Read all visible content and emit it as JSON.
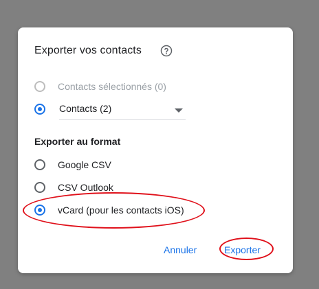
{
  "dialog": {
    "title": "Exporter vos contacts",
    "help_icon": "help-circle-icon",
    "scope": {
      "options": [
        {
          "label": "Contacts sélectionnés (0)",
          "state": "disabled"
        },
        {
          "label": "Contacts (2)",
          "state": "checked"
        }
      ]
    },
    "format": {
      "heading": "Exporter au format",
      "options": [
        {
          "label": "Google CSV",
          "state": "unchecked"
        },
        {
          "label": "CSV Outlook",
          "state": "unchecked"
        },
        {
          "label": "vCard (pour les contacts iOS)",
          "state": "checked"
        }
      ]
    },
    "actions": {
      "cancel_label": "Annuler",
      "export_label": "Exporter"
    }
  },
  "colors": {
    "accent": "#1a73e8",
    "annotation": "#e0111b",
    "backdrop": "#808080"
  }
}
